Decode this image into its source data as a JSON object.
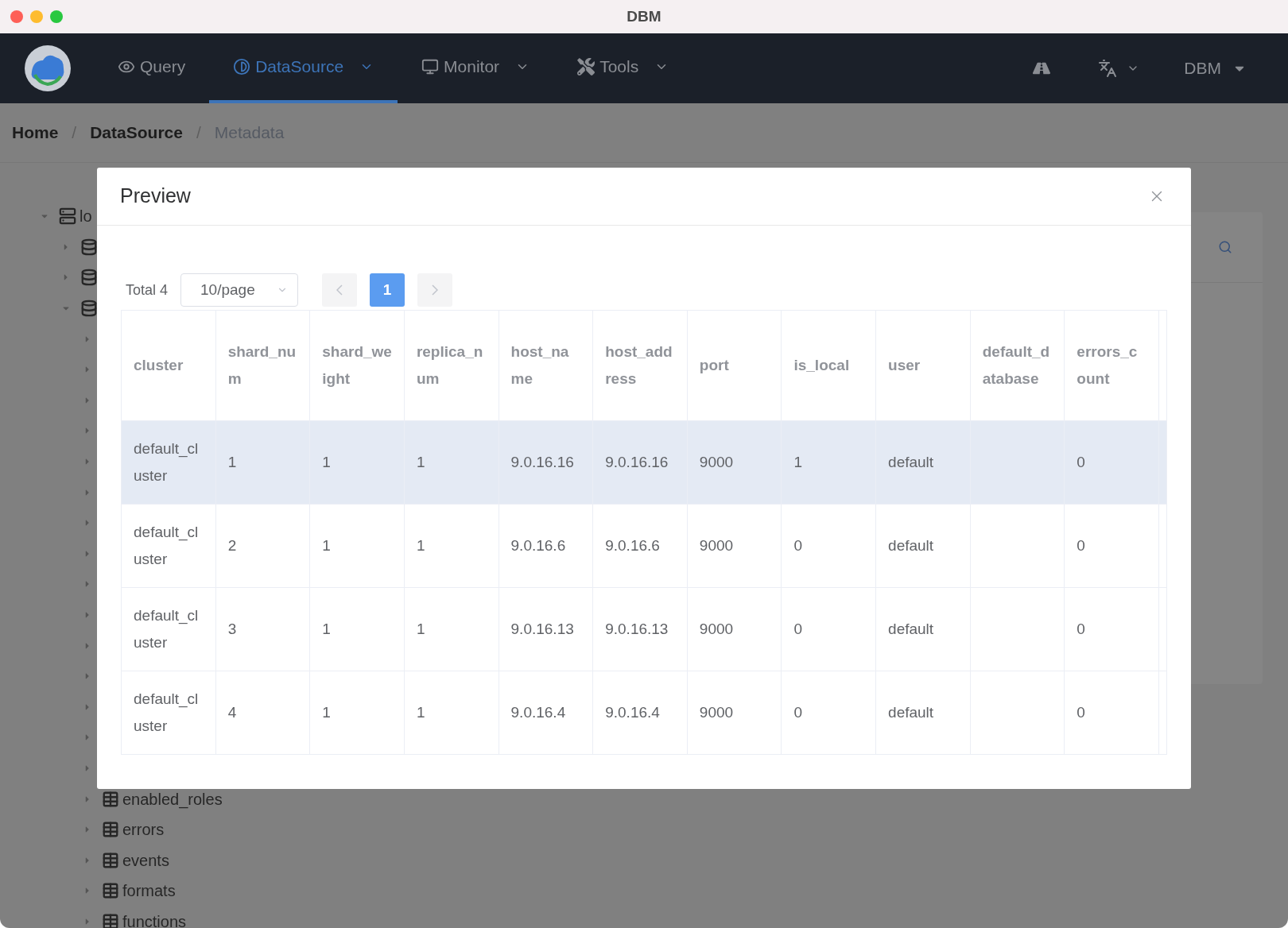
{
  "window": {
    "title": "DBM"
  },
  "nav": {
    "items": [
      {
        "label": "Query",
        "kind": "view",
        "selected": false,
        "dropdown": false
      },
      {
        "label": "DataSource",
        "kind": "datasource",
        "selected": true,
        "dropdown": true
      },
      {
        "label": "Monitor",
        "kind": "monitor",
        "selected": false,
        "dropdown": true
      },
      {
        "label": "Tools",
        "kind": "tools",
        "selected": false,
        "dropdown": true
      }
    ],
    "user": "DBM"
  },
  "breadcrumb": [
    {
      "label": "Home"
    },
    {
      "separator": "/",
      "label": "DataSource"
    },
    {
      "separator": "/",
      "label": "Metadata"
    }
  ],
  "tree": [
    {
      "kind": "server",
      "label": "lo",
      "expanded": true,
      "children": [
        {
          "kind": "database",
          "expanded": false
        },
        {
          "kind": "database",
          "expanded": false
        },
        {
          "kind": "database",
          "expanded": true,
          "children": [
            {
              "expanded": false
            },
            {
              "expanded": false
            },
            {
              "expanded": false
            },
            {
              "expanded": false
            },
            {
              "expanded": false
            },
            {
              "expanded": false
            },
            {
              "expanded": false
            },
            {
              "expanded": false
            },
            {
              "expanded": false
            },
            {
              "expanded": false
            },
            {
              "expanded": false
            },
            {
              "expanded": false
            },
            {
              "expanded": false
            },
            {
              "expanded": false
            },
            {
              "expanded": false
            },
            {
              "kind": "table",
              "label": "enabled_roles",
              "expanded": false
            },
            {
              "kind": "table",
              "label": "errors",
              "expanded": false
            },
            {
              "kind": "table",
              "label": "events",
              "expanded": false
            },
            {
              "kind": "table",
              "label": "formats",
              "expanded": false
            },
            {
              "kind": "table",
              "label": "functions",
              "expanded": false
            }
          ]
        }
      ]
    }
  ],
  "dialog": {
    "title": "Preview",
    "pagination": {
      "total": "Total 4",
      "page_size": "10/page",
      "pages": [
        {
          "label": "1",
          "selected": true
        }
      ]
    },
    "table": {
      "columns": [
        "cluster",
        "shard_num",
        "shard_weight",
        "replica_num",
        "host_name",
        "host_address",
        "port",
        "is_local",
        "user",
        "default_database",
        "errors_count"
      ],
      "rows": [
        {
          "highlighted": true,
          "cells": [
            "default_cluster",
            "1",
            "1",
            "1",
            "9.0.16.16",
            "9.0.16.16",
            "9000",
            "1",
            "default",
            null,
            "0"
          ]
        },
        {
          "highlighted": false,
          "cells": [
            "default_cluster",
            "2",
            "1",
            "1",
            "9.0.16.6",
            "9.0.16.6",
            "9000",
            "0",
            "default",
            null,
            "0"
          ]
        },
        {
          "highlighted": false,
          "cells": [
            "default_cluster",
            "3",
            "1",
            "1",
            "9.0.16.13",
            "9.0.16.13",
            "9000",
            "0",
            "default",
            null,
            "0"
          ]
        },
        {
          "highlighted": false,
          "cells": [
            "default_cluster",
            "4",
            "1",
            "1",
            "9.0.16.4",
            "9.0.16.4",
            "9000",
            "0",
            "default",
            null,
            "0"
          ]
        }
      ]
    }
  }
}
